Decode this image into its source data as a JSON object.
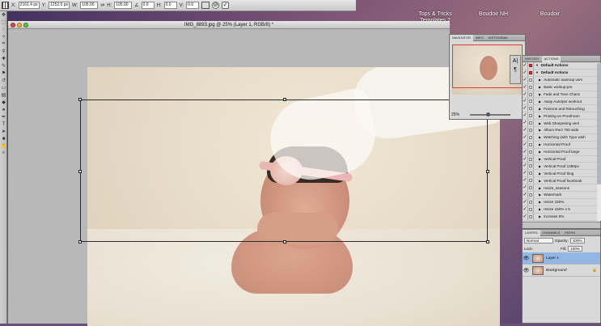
{
  "desktop": {
    "icons": [
      {
        "label": "Tops & Tricks\nTemplates 2"
      },
      {
        "label": "Boudoir NH"
      },
      {
        "label": "Boudoir"
      }
    ]
  },
  "options": {
    "x_value": "2161.4 px",
    "y_value": "1252.0 px",
    "w_value": "105.00",
    "h_value": "105.00",
    "angle_value": "0.0",
    "h_skew": "0.0",
    "v_skew": "0.0",
    "x_label": "X:",
    "y_label": "Y:",
    "w_label": "W:",
    "h_label": "H:",
    "angle_label": "∠",
    "h_label_skew": "H:",
    "v_label_skew": "V:",
    "cancel_symbol": "⊘",
    "commit_symbol": "✓"
  },
  "document": {
    "title": "IMG_8893.jpg @ 25% (Layer 1, RGB/8) *"
  },
  "navigator": {
    "tabs": [
      "NAVIGATOR",
      "INFO",
      "HISTOGRAM"
    ],
    "zoom": "25%"
  },
  "actions_panel": {
    "tabs": [
      "HISTORY",
      "ACTIONS"
    ],
    "items": [
      {
        "label": "Default Actions",
        "kind": "set"
      },
      {
        "label": "Default Actions",
        "kind": "set"
      },
      {
        "label": "Automatic warmup vers",
        "kind": "action"
      },
      {
        "label": "Basic workup-pre",
        "kind": "action"
      },
      {
        "label": "Fade and Tone Chanc",
        "kind": "action"
      },
      {
        "label": "Away Auto/per workout",
        "kind": "action"
      },
      {
        "label": "Pantone and Retouching",
        "kind": "action"
      },
      {
        "label": "Printing on Proofroom",
        "kind": "action"
      },
      {
        "label": "Web Sharpening vers",
        "kind": "action"
      },
      {
        "label": "Album Rect 700 wide",
        "kind": "action"
      },
      {
        "label": "Watching (with Typo wish",
        "kind": "action"
      },
      {
        "label": "Horizontal Proof",
        "kind": "action"
      },
      {
        "label": "Horizontal Proof large",
        "kind": "action"
      },
      {
        "label": "Vertical Proof",
        "kind": "action"
      },
      {
        "label": "Vertical Proof 1280px",
        "kind": "action"
      },
      {
        "label": "Vertical Proof blog",
        "kind": "action"
      },
      {
        "label": "Vertical Proof facebook",
        "kind": "action"
      },
      {
        "label": "resize_seasons",
        "kind": "action"
      },
      {
        "label": "Watermark",
        "kind": "action"
      },
      {
        "label": "resize 150%",
        "kind": "action"
      },
      {
        "label": "resize 150% x 5",
        "kind": "action"
      },
      {
        "label": "increase 5%",
        "kind": "action"
      }
    ]
  },
  "layers": {
    "tabs": [
      "LAYERS",
      "CHANNELS",
      "PATHS"
    ],
    "blend_mode": "Normal",
    "opacity_label": "Opacity:",
    "opacity": "100%",
    "fill_label": "Fill:",
    "fill": "100%",
    "lock_label": "Lock:",
    "items": [
      {
        "name": "Layer 1",
        "selected": true
      },
      {
        "name": "Background",
        "selected": false
      }
    ]
  },
  "colors": {
    "selection": "#93b7e4",
    "nav_view_box": "#e03a3a"
  }
}
